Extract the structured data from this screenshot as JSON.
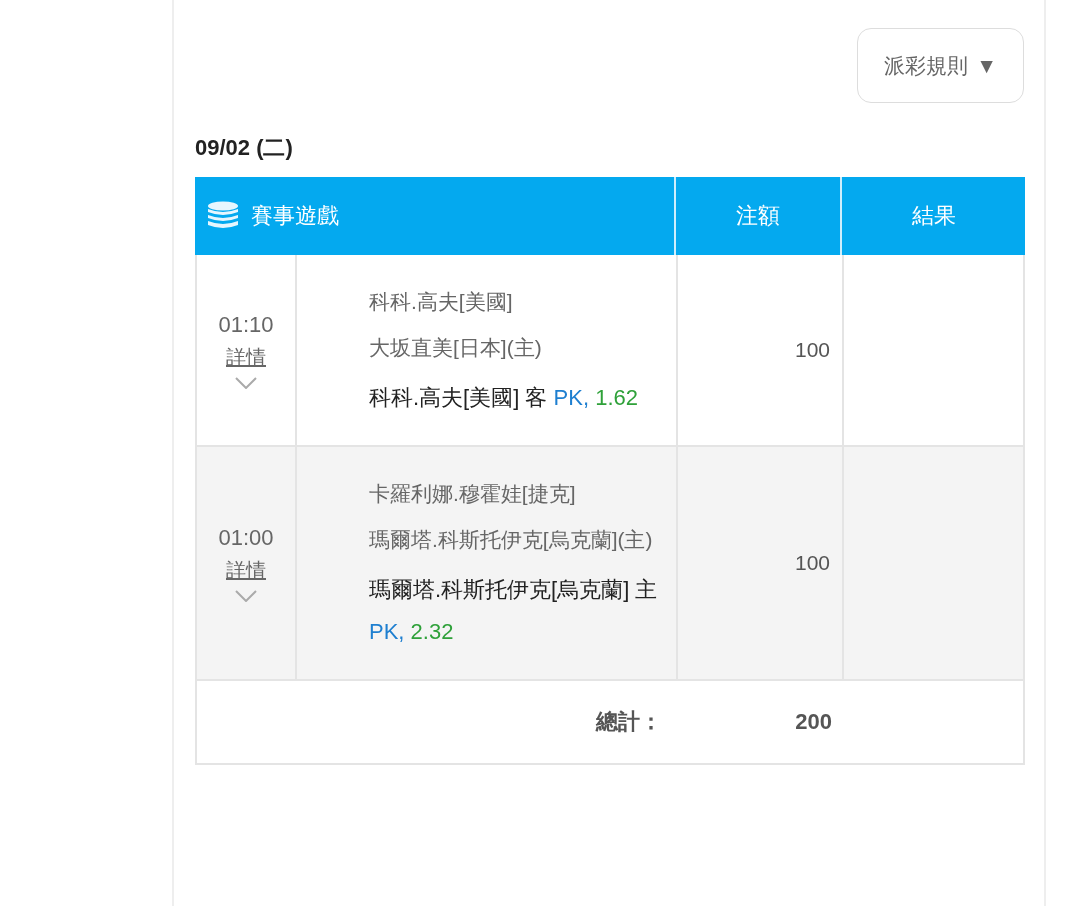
{
  "rules_button": {
    "label": "派彩規則",
    "caret": "▼"
  },
  "date": "09/02 (二)",
  "table": {
    "columns": [
      "賽事遊戲",
      "注額",
      "結果"
    ],
    "rows": [
      {
        "time": "01:10",
        "details": {
          "label": "詳情",
          "expanded": false
        },
        "teams": [
          "科科.高夫[美國]",
          "大坂直美[日本](主)"
        ],
        "bet": {
          "selection": "科科.高夫[美國]",
          "side": "客",
          "handicap": "PK,",
          "odds": "1.62"
        },
        "stake": "100"
      },
      {
        "time": "01:00",
        "details": {
          "label": "詳情",
          "expanded": false
        },
        "teams": [
          "卡羅利娜.穆霍娃[捷克]",
          "瑪爾塔.科斯托伊克[烏克蘭](主)"
        ],
        "bet": {
          "selection": "瑪爾塔.科斯托伊克[烏克蘭]",
          "side": "主",
          "handicap": "PK,",
          "odds": "2.32"
        },
        "stake": "100"
      }
    ],
    "total": {
      "label": "總計：",
      "value": "200"
    }
  }
}
